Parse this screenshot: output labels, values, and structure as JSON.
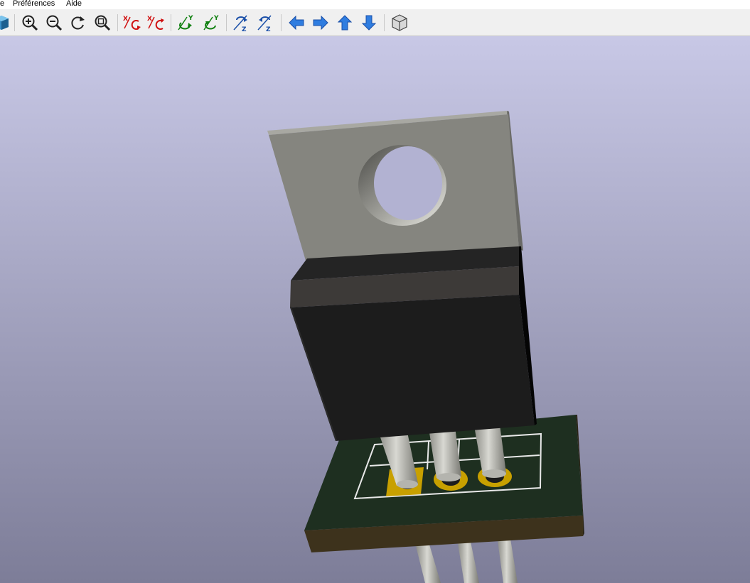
{
  "menu": {
    "item_partial": "e",
    "preferences": "Préférences",
    "help": "Aide"
  },
  "toolbar": {
    "buttons": [
      {
        "name": "3d-view-icon"
      },
      {
        "name": "zoom-in-icon"
      },
      {
        "name": "zoom-out-icon"
      },
      {
        "name": "redraw-icon"
      },
      {
        "name": "zoom-fit-icon"
      },
      {
        "name": "rotate-x-clockwise-icon",
        "axis": "X"
      },
      {
        "name": "rotate-x-counterclockwise-icon",
        "axis": "X"
      },
      {
        "name": "rotate-y-clockwise-icon",
        "axis": "Y"
      },
      {
        "name": "rotate-y-counterclockwise-icon",
        "axis": "Y"
      },
      {
        "name": "rotate-z-clockwise-icon",
        "axis": "Z"
      },
      {
        "name": "rotate-z-counterclockwise-icon",
        "axis": "Z"
      },
      {
        "name": "move-left-icon"
      },
      {
        "name": "move-right-icon"
      },
      {
        "name": "move-up-icon"
      },
      {
        "name": "move-down-icon"
      },
      {
        "name": "orthographic-toggle-icon"
      }
    ]
  },
  "colors": {
    "background_top": "#c8c8e6",
    "background_bottom": "#7d7d98",
    "tab_metal": "#85857f",
    "body_black": "#1c1c1c",
    "pcb_green": "#1e2f20",
    "pcb_edge": "#3d321c",
    "pad_gold": "#c8a000",
    "silkscreen": "#e8e8e8",
    "icon_blue": "#2f7de0",
    "icon_red": "#d01010",
    "icon_green": "#108010"
  }
}
